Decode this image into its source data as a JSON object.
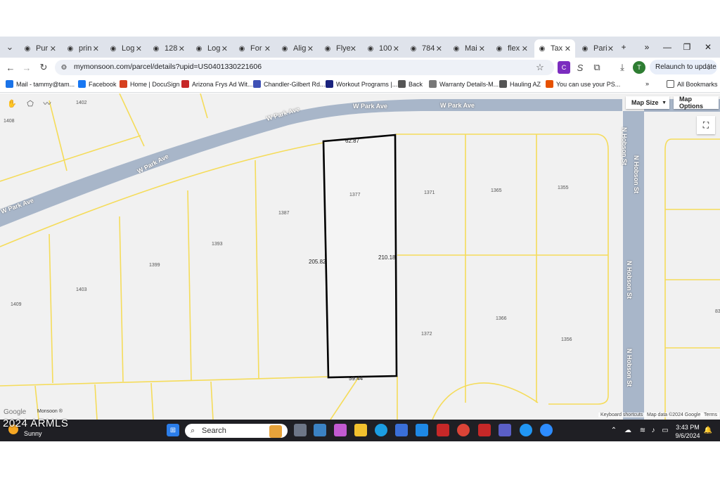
{
  "browser": {
    "tabs": [
      {
        "label": "Pur",
        "icon": "cart-icon"
      },
      {
        "label": "prin",
        "icon": "tool-icon"
      },
      {
        "label": "Log",
        "icon": "store-icon"
      },
      {
        "label": "128",
        "icon": "pin-icon"
      },
      {
        "label": "Log",
        "icon": "store-icon"
      },
      {
        "label": "For",
        "icon": "brand-icon"
      },
      {
        "label": "Alig",
        "icon": "pen-icon"
      },
      {
        "label": "Flye",
        "icon": "doc-icon"
      },
      {
        "label": "100",
        "icon": "pin-icon"
      },
      {
        "label": "784",
        "icon": "pin-icon"
      },
      {
        "label": "Mai",
        "icon": "mail-icon"
      },
      {
        "label": "flex",
        "icon": "pin-icon"
      },
      {
        "label": "Tax",
        "icon": "monsoon-icon"
      },
      {
        "label": "Pari",
        "icon": "doc-icon"
      }
    ],
    "url": "mymonsoon.com/parcel/details?upid=US0401330221606",
    "relaunch_label": "Relaunch to update",
    "profile_initial": "T",
    "bookmarks": [
      {
        "label": "Mail - tammy@tam...",
        "color": "#1a73e8"
      },
      {
        "label": "Facebook",
        "color": "#1877f2"
      },
      {
        "label": "Home | DocuSign",
        "color": "#d6401f"
      },
      {
        "label": "Arizona Frys Ad Wit...",
        "color": "#c62828"
      },
      {
        "label": "Chandler-Gilbert Rd...",
        "color": "#3f51b5"
      },
      {
        "label": "Workout Programs |...",
        "color": "#1a237e"
      },
      {
        "label": "Back",
        "color": "#555555"
      },
      {
        "label": "Warranty Details-M...",
        "color": "#777777"
      },
      {
        "label": "Hauling AZ",
        "color": "#555555"
      },
      {
        "label": "You can use your PS...",
        "color": "#e65100"
      }
    ],
    "all_bookmarks": "All Bookmarks"
  },
  "map": {
    "map_size_label": "Map Size",
    "map_options_label": "Map Options",
    "streets": [
      "W Park Ave",
      "W Park Ave",
      "W Park Ave",
      "W Park Ave",
      "W Park Ave",
      "N Hobson St",
      "N Hobson St",
      "N Hobson St",
      "N Hobson St"
    ],
    "lots": [
      "1402",
      "1408",
      "1377",
      "1371",
      "1365",
      "1355",
      "1387",
      "1393",
      "1399",
      "1403",
      "1409",
      "1366",
      "1372",
      "1356",
      "83"
    ],
    "dimensions": [
      "62.87",
      "205.82",
      "210.18",
      "59.44"
    ],
    "google_label": "Google",
    "monsoon_label": "Monsoon ®",
    "attribution": [
      "Keyboard shortcuts",
      "Map data ©2024 Google",
      "Terms"
    ],
    "road_color": "#a7b5c8",
    "line_color": "#f5dc5a"
  },
  "taskbar": {
    "weather_temp": "Sunny",
    "search_placeholder": "Search",
    "time": "3:43 PM",
    "date": "9/6/2024"
  },
  "watermark": "2024 ARMLS"
}
